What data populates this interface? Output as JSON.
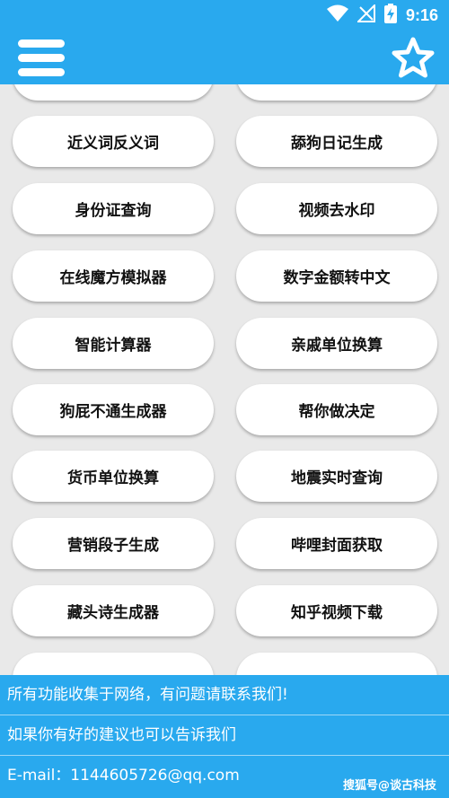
{
  "status_bar": {
    "time": "9:16",
    "icons": [
      "wifi-icon",
      "no-signal-icon",
      "battery-charging-icon"
    ]
  },
  "app_bar": {
    "menu_icon": "menu-icon",
    "favorite_icon": "star-icon"
  },
  "tools": [
    {
      "left": "",
      "right": ""
    },
    {
      "left": "近义词反义词",
      "right": "舔狗日记生成"
    },
    {
      "left": "身份证查询",
      "right": "视频去水印"
    },
    {
      "left": "在线魔方模拟器",
      "right": "数字金额转中文"
    },
    {
      "left": "智能计算器",
      "right": "亲戚单位换算"
    },
    {
      "left": "狗屁不通生成器",
      "right": "帮你做决定"
    },
    {
      "left": "货币单位换算",
      "right": "地震实时查询"
    },
    {
      "left": "营销段子生成",
      "right": "哔哩封面获取"
    },
    {
      "left": "藏头诗生成器",
      "right": "知乎视频下载"
    },
    {
      "left": "",
      "right": ""
    }
  ],
  "footer": {
    "line1": "所有功能收集于网络，有问题请联系我们!",
    "line2": "如果你有好的建议也可以告诉我们",
    "line3": "E-mail：1144605726@qq.com"
  },
  "watermark": "搜狐号@谈古科技",
  "colors": {
    "primary": "#29a9ee",
    "background": "#e9e9e9",
    "button": "#ffffff"
  }
}
